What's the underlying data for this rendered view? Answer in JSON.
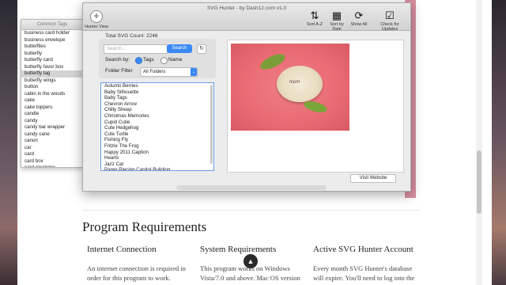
{
  "app": {
    "window_title": "SVG Hunter - by Dash12.com  v1.0",
    "toolbar": {
      "hunter_view": "Hunter View",
      "sort_az": "Sort A-Z",
      "sort_by_date": "Sort by Date",
      "show_all": "Show All",
      "check_updates": "Check for Updates"
    },
    "total_count": "Total SVG Count: 2246",
    "search": {
      "placeholder": "Search...",
      "button": "Search"
    },
    "search_by": {
      "label": "Search by:",
      "tags": "Tags",
      "name": "Name"
    },
    "folder_filter": {
      "label": "Folder Filter",
      "value": "All Folders"
    },
    "list_items": [
      "Autumn Berries",
      "Baby Silhouette",
      "Baby Tags",
      "Chevron Arrow",
      "Chilly Sheep",
      "Christmas Memories",
      "Cupid Cutie",
      "Cute Hedgehog",
      "Cute Turtle",
      "Fishing Fly",
      "Fritzie The Frog",
      "Happy 2011 Caption",
      "Hearts",
      "Jazz Cat",
      "Paper Piecing Capitol Building"
    ],
    "preview_text": "mom",
    "visit_button": "Visit Website"
  },
  "tags_window": {
    "title": "Common Tags",
    "items": [
      "business card holder",
      "business envelope",
      "butterflies",
      "butterfly",
      "butterfly card",
      "butterfly favor box",
      "butterfly tag",
      "butterfly wings",
      "button",
      "cabin in the woods",
      "cake",
      "cake toppers",
      "candle",
      "candy",
      "candy bar wrapper",
      "candy cane",
      "canon",
      "car",
      "card",
      "card box",
      "card envelope",
      "card folder - 2 pockets"
    ],
    "selected_index": 6
  },
  "page": {
    "section_title": "Program Requirements",
    "columns": [
      {
        "heading": "Internet Connection",
        "text": "An internet connection is required in order for this program to work."
      },
      {
        "heading": "System Requirements",
        "text": "This program works on Windows Vista/7.0 and above. Mac OS version"
      },
      {
        "heading": "Active SVG Hunter Account",
        "text": "Every month SVG Hunter's database will expire. You'll need to log into the"
      }
    ],
    "scroll_up_icon": "chevron-up-icon"
  }
}
